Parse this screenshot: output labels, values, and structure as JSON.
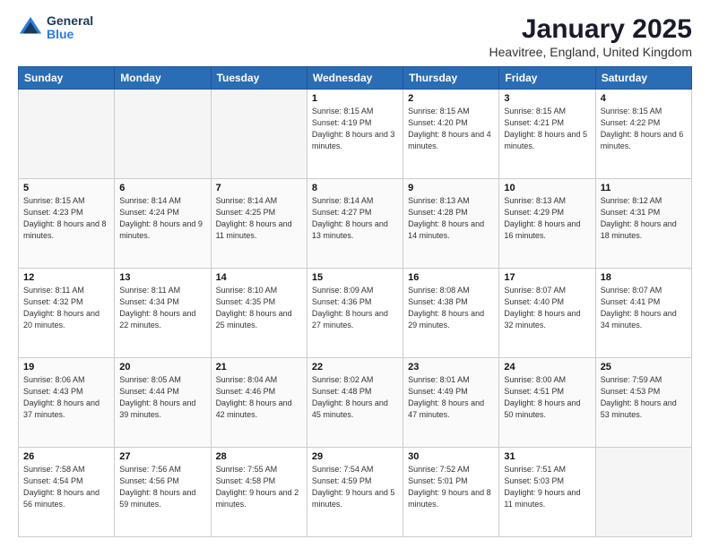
{
  "logo": {
    "general": "General",
    "blue": "Blue"
  },
  "title": "January 2025",
  "location": "Heavitree, England, United Kingdom",
  "days_header": [
    "Sunday",
    "Monday",
    "Tuesday",
    "Wednesday",
    "Thursday",
    "Friday",
    "Saturday"
  ],
  "weeks": [
    [
      {
        "day": "",
        "info": ""
      },
      {
        "day": "",
        "info": ""
      },
      {
        "day": "",
        "info": ""
      },
      {
        "day": "1",
        "info": "Sunrise: 8:15 AM\nSunset: 4:19 PM\nDaylight: 8 hours and 3 minutes."
      },
      {
        "day": "2",
        "info": "Sunrise: 8:15 AM\nSunset: 4:20 PM\nDaylight: 8 hours and 4 minutes."
      },
      {
        "day": "3",
        "info": "Sunrise: 8:15 AM\nSunset: 4:21 PM\nDaylight: 8 hours and 5 minutes."
      },
      {
        "day": "4",
        "info": "Sunrise: 8:15 AM\nSunset: 4:22 PM\nDaylight: 8 hours and 6 minutes."
      }
    ],
    [
      {
        "day": "5",
        "info": "Sunrise: 8:15 AM\nSunset: 4:23 PM\nDaylight: 8 hours and 8 minutes."
      },
      {
        "day": "6",
        "info": "Sunrise: 8:14 AM\nSunset: 4:24 PM\nDaylight: 8 hours and 9 minutes."
      },
      {
        "day": "7",
        "info": "Sunrise: 8:14 AM\nSunset: 4:25 PM\nDaylight: 8 hours and 11 minutes."
      },
      {
        "day": "8",
        "info": "Sunrise: 8:14 AM\nSunset: 4:27 PM\nDaylight: 8 hours and 13 minutes."
      },
      {
        "day": "9",
        "info": "Sunrise: 8:13 AM\nSunset: 4:28 PM\nDaylight: 8 hours and 14 minutes."
      },
      {
        "day": "10",
        "info": "Sunrise: 8:13 AM\nSunset: 4:29 PM\nDaylight: 8 hours and 16 minutes."
      },
      {
        "day": "11",
        "info": "Sunrise: 8:12 AM\nSunset: 4:31 PM\nDaylight: 8 hours and 18 minutes."
      }
    ],
    [
      {
        "day": "12",
        "info": "Sunrise: 8:11 AM\nSunset: 4:32 PM\nDaylight: 8 hours and 20 minutes."
      },
      {
        "day": "13",
        "info": "Sunrise: 8:11 AM\nSunset: 4:34 PM\nDaylight: 8 hours and 22 minutes."
      },
      {
        "day": "14",
        "info": "Sunrise: 8:10 AM\nSunset: 4:35 PM\nDaylight: 8 hours and 25 minutes."
      },
      {
        "day": "15",
        "info": "Sunrise: 8:09 AM\nSunset: 4:36 PM\nDaylight: 8 hours and 27 minutes."
      },
      {
        "day": "16",
        "info": "Sunrise: 8:08 AM\nSunset: 4:38 PM\nDaylight: 8 hours and 29 minutes."
      },
      {
        "day": "17",
        "info": "Sunrise: 8:07 AM\nSunset: 4:40 PM\nDaylight: 8 hours and 32 minutes."
      },
      {
        "day": "18",
        "info": "Sunrise: 8:07 AM\nSunset: 4:41 PM\nDaylight: 8 hours and 34 minutes."
      }
    ],
    [
      {
        "day": "19",
        "info": "Sunrise: 8:06 AM\nSunset: 4:43 PM\nDaylight: 8 hours and 37 minutes."
      },
      {
        "day": "20",
        "info": "Sunrise: 8:05 AM\nSunset: 4:44 PM\nDaylight: 8 hours and 39 minutes."
      },
      {
        "day": "21",
        "info": "Sunrise: 8:04 AM\nSunset: 4:46 PM\nDaylight: 8 hours and 42 minutes."
      },
      {
        "day": "22",
        "info": "Sunrise: 8:02 AM\nSunset: 4:48 PM\nDaylight: 8 hours and 45 minutes."
      },
      {
        "day": "23",
        "info": "Sunrise: 8:01 AM\nSunset: 4:49 PM\nDaylight: 8 hours and 47 minutes."
      },
      {
        "day": "24",
        "info": "Sunrise: 8:00 AM\nSunset: 4:51 PM\nDaylight: 8 hours and 50 minutes."
      },
      {
        "day": "25",
        "info": "Sunrise: 7:59 AM\nSunset: 4:53 PM\nDaylight: 8 hours and 53 minutes."
      }
    ],
    [
      {
        "day": "26",
        "info": "Sunrise: 7:58 AM\nSunset: 4:54 PM\nDaylight: 8 hours and 56 minutes."
      },
      {
        "day": "27",
        "info": "Sunrise: 7:56 AM\nSunset: 4:56 PM\nDaylight: 8 hours and 59 minutes."
      },
      {
        "day": "28",
        "info": "Sunrise: 7:55 AM\nSunset: 4:58 PM\nDaylight: 9 hours and 2 minutes."
      },
      {
        "day": "29",
        "info": "Sunrise: 7:54 AM\nSunset: 4:59 PM\nDaylight: 9 hours and 5 minutes."
      },
      {
        "day": "30",
        "info": "Sunrise: 7:52 AM\nSunset: 5:01 PM\nDaylight: 9 hours and 8 minutes."
      },
      {
        "day": "31",
        "info": "Sunrise: 7:51 AM\nSunset: 5:03 PM\nDaylight: 9 hours and 11 minutes."
      },
      {
        "day": "",
        "info": ""
      }
    ]
  ]
}
